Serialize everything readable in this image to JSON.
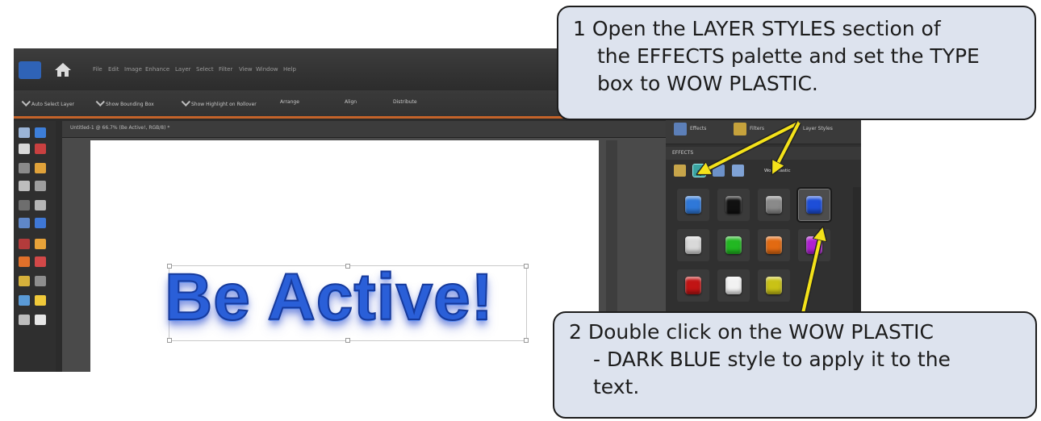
{
  "app": {
    "menu": [
      "File",
      "Edit",
      "Image",
      "Enhance",
      "Layer",
      "Select",
      "Filter",
      "View",
      "Window",
      "Help"
    ],
    "options": [
      "Auto Select Layer",
      "Show Bounding Box",
      "Show Highlight on Rollover",
      "Arrange",
      "Align",
      "Distribute"
    ],
    "document_title": "Untitled-1 @ 66.7% (Be Active!, RGB/8) *",
    "canvas_text": "Be Active!"
  },
  "panel": {
    "tabs": [
      "Effects",
      "Filters",
      "Layer Styles"
    ],
    "section_title": "EFFECTS",
    "type_value": "Wow Plastic",
    "swatch_colors": [
      "#2f78d8",
      "#111111",
      "#8a8a8a",
      "#1d4ed8",
      "#d9d9d9",
      "#22b822",
      "#e26a12",
      "#b01fd3",
      "#c11414",
      "#f2f2f2",
      "#c9c216"
    ]
  },
  "callouts": {
    "step1": {
      "line1": "1  Open the LAYER STYLES section of",
      "line2": "the EFFECTS palette and set the TYPE",
      "line3": "box to WOW PLASTIC."
    },
    "step2": {
      "line1": "2  Double click on the WOW PLASTIC",
      "line2": "- DARK BLUE style to apply it to the",
      "line3": "text."
    }
  },
  "colors": {
    "callout_fill": "#dde3ee",
    "arrow_yellow": "#f4e21a",
    "accent_orange": "#c4632a"
  }
}
